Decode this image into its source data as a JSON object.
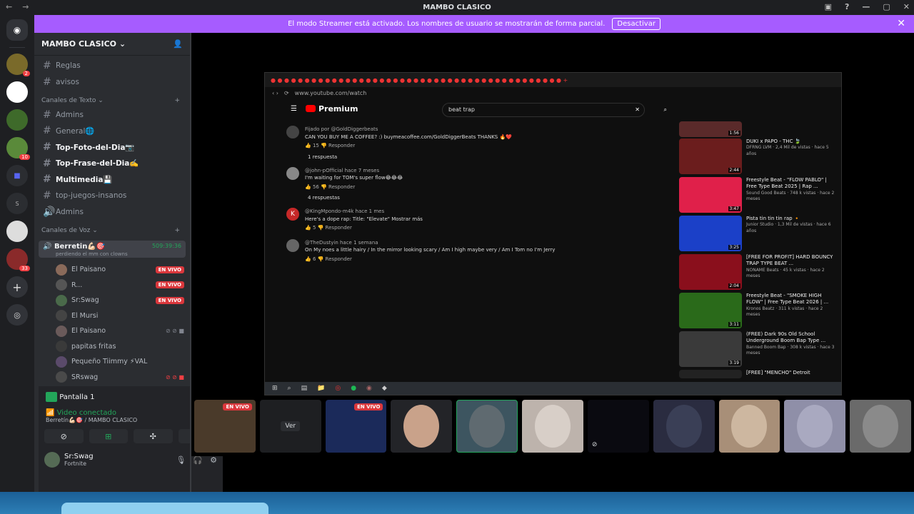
{
  "window": {
    "title": "MAMBO CLASICO"
  },
  "banner": {
    "text": "El modo Streamer está activado. Los nombres de usuario se mostrarán de forma parcial.",
    "button": "Desactivar"
  },
  "guilds": [
    {
      "badge": ""
    },
    {
      "badge": "2"
    },
    {
      "badge": ""
    },
    {
      "badge": ""
    },
    {
      "badge": "10"
    },
    {
      "badge": ""
    },
    {
      "badge": ""
    },
    {
      "badge": ""
    },
    {
      "badge": "33"
    }
  ],
  "server": {
    "name": "MAMBO CLASICO"
  },
  "channels_top": [
    {
      "label": "Reglas",
      "bold": false
    },
    {
      "label": "avisos",
      "bold": false
    }
  ],
  "text_category": "Canales de Texto",
  "text_channels": [
    {
      "label": "Admins"
    },
    {
      "label": "General🌐"
    },
    {
      "label": "Top-Foto-del-Dia📷"
    },
    {
      "label": "Top-Frase-del-Dia✍️"
    },
    {
      "label": "Multimedia💾"
    },
    {
      "label": "top-juegos-insanos"
    },
    {
      "label": "Admins"
    }
  ],
  "voice_category": "Canales de Voz",
  "voice_channel": {
    "name": "Berretin💪🏻🎯",
    "time": "509:39:36",
    "status": "perdiendo el mm con clowns"
  },
  "voice_users": [
    {
      "name": "El Paisano",
      "live": "EN VIVO"
    },
    {
      "name": "R...",
      "live": "EN VIVO"
    },
    {
      "name": "Sr:Swag",
      "live": "EN VIVO"
    },
    {
      "name": "El Mursi",
      "live": ""
    },
    {
      "name": "El Paisano",
      "live": ""
    },
    {
      "name": "papitas fritas",
      "live": ""
    },
    {
      "name": "Pequeño Tiimmy ⚡VAL",
      "live": ""
    },
    {
      "name": "SRswag",
      "live": ""
    }
  ],
  "panel": {
    "screen": "Pantalla 1",
    "video_connected": "Video conectado",
    "channel_path": "Berretín💪🏻🎯 / MAMBO CLASICO",
    "user": "Sr:Swag",
    "activity": "Fortnite"
  },
  "browser": {
    "url": "www.youtube.com/watch",
    "search": "beat trap",
    "premium": "Premium"
  },
  "comments": [
    {
      "user": "Fijado por @GoldDiggerbeats",
      "text": "CAN YOU BUY ME A COFFEE? :) buymeacoffee.com/GoldDiggerBeats THANKS 🔥❤️",
      "actions": "👍 15  👎  Responder",
      "replies": "1 respuesta"
    },
    {
      "user": "@john-pOfficial  hace 7 meses",
      "text": "I'm waiting for TOM's super flow😂😂😂",
      "actions": "👍 56  👎  Responder",
      "replies": "4 respuestas"
    },
    {
      "user": "@KingMpondo-m4k  hace 1 mes",
      "text": "Here's a dope rap: Title: \"Elevate\" Mostrar más",
      "actions": "👍 5  👎  Responder",
      "replies": ""
    },
    {
      "user": "@TheDustyin  hace 1 semana",
      "text": "On My noes a little hairy / In the mirror looking scary / Am I high maybe very / Am I Tom no I'm Jerry",
      "actions": "👍 6  👎  Responder",
      "replies": ""
    }
  ],
  "recs": [
    {
      "title": "",
      "meta": "",
      "duration": "1:56",
      "color": "#5a2a2a"
    },
    {
      "title": "DUKI x PAPO - THC 🍃",
      "meta": "DFRNG LVM · 2,4 Mil de vistas · hace 5 años",
      "duration": "2:44",
      "color": "#6b1d1d"
    },
    {
      "title": "Freestyle Beat - \"FLOW PABLO\" | Free Type Beat 2025 | Rap ...",
      "meta": "Sound Good Beats · 748 k vistas · hace 2 meses",
      "duration": "3:47",
      "color": "#e0204a"
    },
    {
      "title": "Pista tin tin tin rap 🔸",
      "meta": "Junior Studio · 1,3 Mil de vistas · hace 6 años",
      "duration": "3:25",
      "color": "#1b40c8"
    },
    {
      "title": "[FREE FOR PROFIT] HARD BOUNCY TRAP TYPE BEAT ...",
      "meta": "NONAME Beats · 45 k vistas · hace 2 meses",
      "duration": "2:04",
      "color": "#8a0f1c"
    },
    {
      "title": "Freestyle Beat - \"SMOKE HIGH FLOW\" | Free Type Beat 2026 | ...",
      "meta": "Kronos Beatz · 311 k vistas · hace 2 meses",
      "duration": "3:11",
      "color": "#2a6a1a"
    },
    {
      "title": "(FREE) Dark 90s Old School Underground Boom Bap Type ...",
      "meta": "Banned Boom Bap · 308 k vistas · hace 3 meses",
      "duration": "3:19",
      "color": "#3a3a3a"
    },
    {
      "title": "[FREE] \"MENCHO\" Detroit",
      "meta": "",
      "duration": "",
      "color": "#222"
    }
  ],
  "tiles": [
    {
      "live": "EN VIVO",
      "label": "",
      "color": "#4a3a2a"
    },
    {
      "live": "",
      "label": "Ver",
      "color": "#1e1f22"
    },
    {
      "live": "EN VIVO",
      "label": "",
      "color": "#1b2a5a"
    },
    {
      "live": "",
      "label": "",
      "color": "#c9a28a"
    },
    {
      "live": "",
      "label": "",
      "color": "#5f6a70"
    },
    {
      "live": "",
      "label": "",
      "color": "#d8cfc8"
    },
    {
      "live": "",
      "label": "",
      "color": "#0a0a10"
    },
    {
      "live": "",
      "label": "",
      "color": "#3a3f56"
    },
    {
      "live": "",
      "label": "",
      "color": "#cdb7a0"
    },
    {
      "live": "",
      "label": "",
      "color": "#a9a9c0"
    },
    {
      "live": "",
      "label": "",
      "color": "#8a8a8a"
    }
  ]
}
